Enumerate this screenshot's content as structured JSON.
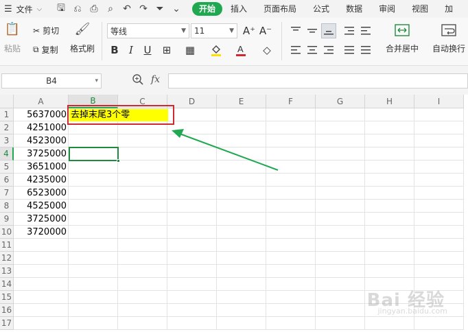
{
  "menubar": {
    "file_label": "文件",
    "tabs": [
      {
        "label": "开始",
        "active": true
      },
      {
        "label": "插入",
        "active": false
      },
      {
        "label": "页面布局",
        "active": false
      },
      {
        "label": "公式",
        "active": false
      },
      {
        "label": "数据",
        "active": false
      },
      {
        "label": "审阅",
        "active": false
      },
      {
        "label": "视图",
        "active": false
      },
      {
        "label": "加",
        "active": false
      }
    ],
    "quick_icons": [
      "save-icon",
      "format-painter-icon",
      "print-icon",
      "print-preview-icon",
      "undo-icon",
      "redo-icon",
      "filter-icon",
      "more-icon"
    ]
  },
  "ribbon": {
    "paste_label": "粘贴",
    "cut_label": "剪切",
    "copy_label": "复制",
    "format_painter_label": "格式刷",
    "font_name": "等线",
    "font_size": "11",
    "merge_center_label": "合并居中",
    "wrap_text_label": "自动换行",
    "fill_color": "#ffe000",
    "font_color": "#d0282f"
  },
  "formula_bar": {
    "name_box": "B4",
    "fx_label": "fx",
    "formula_value": ""
  },
  "sheet": {
    "columns": [
      "A",
      "B",
      "C",
      "D",
      "E",
      "F",
      "G",
      "H",
      "I"
    ],
    "active_column": "B",
    "active_row": 4,
    "rows": [
      "1",
      "2",
      "3",
      "4",
      "5",
      "6",
      "7",
      "8",
      "9",
      "10",
      "11",
      "12",
      "13",
      "14",
      "15",
      "16",
      "17"
    ],
    "column_a_values": [
      "5637000",
      "4251000",
      "4523000",
      "3725000",
      "3651000",
      "4235000",
      "6523000",
      "4525000",
      "3725000",
      "3720000"
    ],
    "note_text": "去掉末尾3个零",
    "highlight_color": "#ffff00",
    "annotation_color": "#d0282f",
    "arrow_color": "#1fa84f"
  },
  "watermark": {
    "text": "Bai 经验",
    "sub": "jingyan.baidu.com"
  }
}
